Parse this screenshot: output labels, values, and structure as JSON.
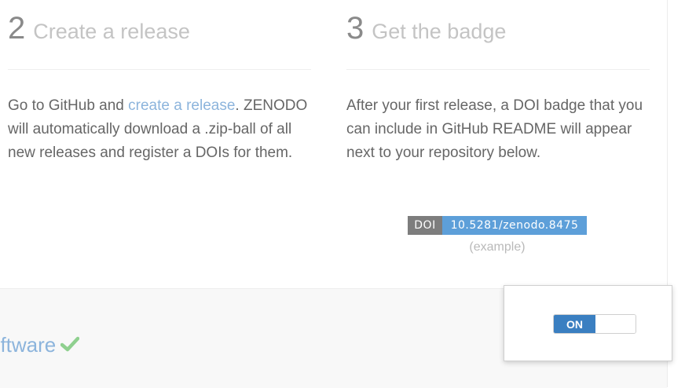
{
  "step2": {
    "number": "2",
    "title": "Create a release",
    "text_before_link": "Go to GitHub and ",
    "link_text": "create a release",
    "text_after_link": ". ZENODO will automatically download a .zip-ball of all new releases and register a DOIs for them."
  },
  "step3": {
    "number": "3",
    "title": "Get the badge",
    "text": "After your first release, a DOI badge that you can include in GitHub README will appear next to your repository below."
  },
  "badge": {
    "label": "DOI",
    "value": "10.5281/zenodo.8475",
    "caption": "(example)"
  },
  "repository": {
    "name_visible": "oftware",
    "status_icon": "check-icon"
  },
  "toggle": {
    "label": "ON",
    "state": "on"
  },
  "colors": {
    "link": "#8cb4dc",
    "badge_label_bg": "#7d7d7d",
    "badge_value_bg": "#5d9fd9",
    "toggle_on_bg": "#3a7fc1",
    "check": "#8fd08f"
  }
}
